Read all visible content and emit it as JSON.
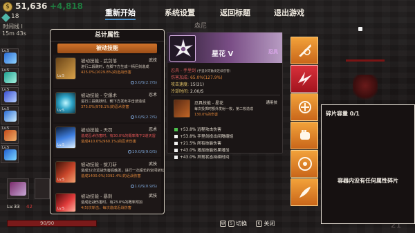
{
  "hud": {
    "gold": "51,636",
    "gold_gain": "+4,818",
    "gems": "18",
    "time_label": "时间线 I",
    "time_value": "15m 43s",
    "level": "Lv.33",
    "level_red": "42",
    "hp_text": "90/90",
    "right_level": "21"
  },
  "menu": {
    "restart": "重新开始",
    "settings": "系统设置",
    "back_title": "返回标题",
    "quit": "退出游戏",
    "sub": "森尼"
  },
  "left_panel": {
    "title": "总计属性",
    "tab": "被动技能",
    "cards": [
      {
        "name": "被动技能 - 武剑落",
        "tag": "武技",
        "line1": "进行二段跳时，在脚下方生成一柄巨剑造成",
        "line2": "425.0%(1029.8%)的近战伤害",
        "cd": "3.0/S(2.7/S)",
        "lv": "Lv.5"
      },
      {
        "name": "被动技能 - 空爆术",
        "tag": "忍术",
        "line1": "进行二段跳跃时，朝下方发出冲击波造成",
        "line2": "375.0%(978.1%)的忍术伤害",
        "cd": "3.0/S(2.7/S)",
        "lv": "Lv.5"
      },
      {
        "name": "被动技能 - 天罚",
        "tag": "忍术",
        "line1": "造成忍术伤害时，有30.0%的概率降下2道天雷",
        "line2": "造成410.0%(960.1%)的忍术伤害",
        "cd": "10.0/S(9.0/S)",
        "lv": "Lv.5"
      },
      {
        "name": "被动技能 - 拔刀斩",
        "tag": "武技",
        "line1": "造成32次近战伤害后触发，进行一次超长的空间斩切",
        "line2": "造成1400.0%(3392.4%)的近战伤害",
        "cd": "1.0/S(0.9/S)",
        "lv": "Lv.5"
      },
      {
        "name": "被动技能 - 暴刺",
        "tag": "武技",
        "line1": "造成近战伤害时，有23.0%的概率附加",
        "line2": "4(5)次斩击，每次造成近战伤害",
        "cd": "3.0/S(2.7/S)",
        "lv": "Lv.5"
      }
    ]
  },
  "detail": {
    "name": "星花 V",
    "tag": "忍具",
    "type_line": "忍具 - 手里剑",
    "type_note": "(手里剑可触发连续伤害)",
    "row1_label": "伤害加成:",
    "row1_value": "65.0%(127.9%)",
    "row2_label": "攻击速度:",
    "row2_value": "15(21)",
    "row3_label": "冷却时间:",
    "row3_value": "2.00/S",
    "skill_name": "忍具技能 - 星花",
    "skill_tag": "通用技",
    "skill_line1": "每次投掷时额外发射一枚，第二枚造成",
    "skill_line2": "130.0%的伤害",
    "bonuses": [
      {
        "text": "+53.8% 远程攻击伤害",
        "color": "#4ec24e"
      },
      {
        "text": "+53.8% 手里剑投出间隔缩短",
        "color": "#f2f2f2"
      },
      {
        "text": "+21.5% 所有技能伤害",
        "color": "#f2f2f2"
      },
      {
        "text": "+43.0% 增加技能效果增加",
        "color": "#f2f2f2"
      },
      {
        "text": "+43.0% 异常状态持续时间",
        "color": "#f2f2f2"
      }
    ]
  },
  "right_panel": {
    "title": "碎片容量 0/1",
    "message": "容器内没有任何属性碎片"
  },
  "hint": {
    "key_w": "W",
    "key_s": "S",
    "switch": "切换",
    "key_k": "K",
    "close": "关闭"
  }
}
